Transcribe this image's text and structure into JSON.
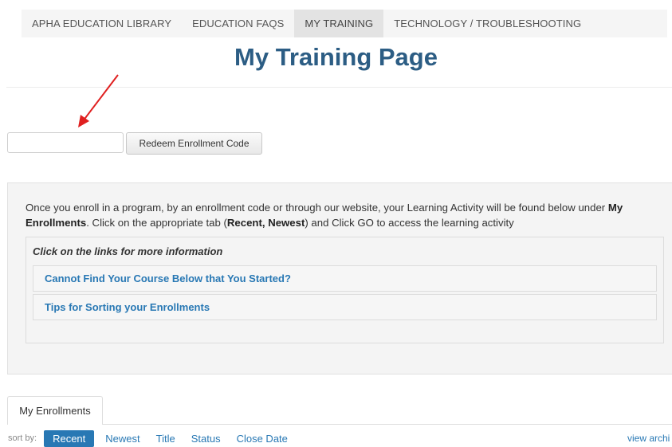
{
  "nav": {
    "items": [
      {
        "label": "APHA EDUCATION LIBRARY"
      },
      {
        "label": "EDUCATION FAQS"
      },
      {
        "label": "MY TRAINING"
      },
      {
        "label": "TECHNOLOGY / TROUBLESHOOTING"
      }
    ],
    "active_index": 2
  },
  "page": {
    "title": "My Training Page"
  },
  "enrollment": {
    "code_value": "",
    "code_placeholder": "",
    "redeem_label": "Redeem Enrollment Code"
  },
  "info": {
    "text_part1": "Once you enroll in a program, by an enrollment code or through our website, your Learning Activity will be found below under ",
    "text_bold1": "My Enrollments",
    "text_part2": ". Click on the appropriate tab (",
    "text_bold2": "Recent, Newest",
    "text_part3": ") and Click GO to access the learning activity",
    "links_heading": "Click on the links for more information",
    "links": [
      {
        "label": "Cannot Find Your Course Below that You Started?"
      },
      {
        "label": "Tips for Sorting your Enrollments"
      }
    ]
  },
  "tabs": {
    "my_enrollments": "My Enrollments"
  },
  "sort": {
    "label": "sort by:",
    "options": [
      {
        "label": "Recent"
      },
      {
        "label": "Newest"
      },
      {
        "label": "Title"
      },
      {
        "label": "Status"
      },
      {
        "label": "Close Date"
      }
    ],
    "active_index": 0,
    "view_archive": "view archi"
  },
  "colors": {
    "title": "#2c5d84",
    "link": "#2878b4",
    "arrow": "#e02020",
    "panel_bg": "#f4f4f4"
  },
  "icons": {
    "annotation": "red-arrow-icon"
  }
}
